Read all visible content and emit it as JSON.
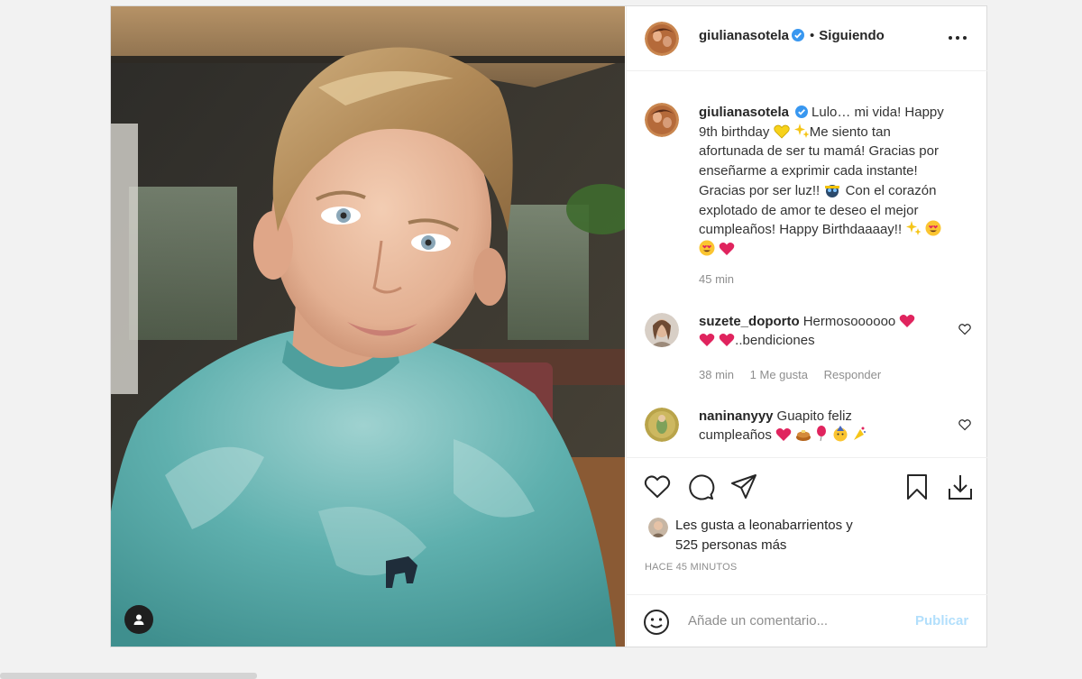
{
  "post": {
    "author": "giulianasotela",
    "follow_status": "Siguiendo",
    "dot": "•",
    "caption": {
      "username": "giulianasotela",
      "line1": "Lulo… mi vida! Happy",
      "line2": "9th birthday",
      "line3": "Me siento tan",
      "line4": "afortunada de ser tu mamá! Gracias por",
      "line5": "enseñarme a exprimir cada instante!",
      "line6": "Gracias por ser luz!!",
      "line6b": "Con el corazón",
      "line7": "explotado de amor te deseo el mejor",
      "line8": "cumpleaños! Happy Birthdaaaay!!",
      "time": "45 min"
    },
    "comments": [
      {
        "username": "suzete_doporto",
        "text1": "Hermosoooooo",
        "text2": "..bendiciones",
        "time": "38 min",
        "likes": "1 Me gusta",
        "reply": "Responder"
      },
      {
        "username": "naninanyyy",
        "text1": "Guapito feliz",
        "text2": "cumpleaños"
      }
    ],
    "likes": {
      "prefix": "Les gusta a ",
      "user": "leonabarrientos",
      "mid": " y",
      "count": "525 personas más"
    },
    "time_ago": "HACE 45 MINUTOS",
    "comment_input": {
      "placeholder": "Añade un comentario...",
      "publish": "Publicar"
    },
    "colors": {
      "verified": "#3897f0",
      "heart": "#ed4956",
      "publish_disabled": "#b2dffc",
      "meta": "#8e8e8e"
    },
    "icons": [
      "more-icon",
      "verified-icon",
      "like-icon",
      "comment-icon",
      "share-icon",
      "save-icon",
      "download-icon",
      "smile-icon",
      "tag-user-icon"
    ]
  }
}
